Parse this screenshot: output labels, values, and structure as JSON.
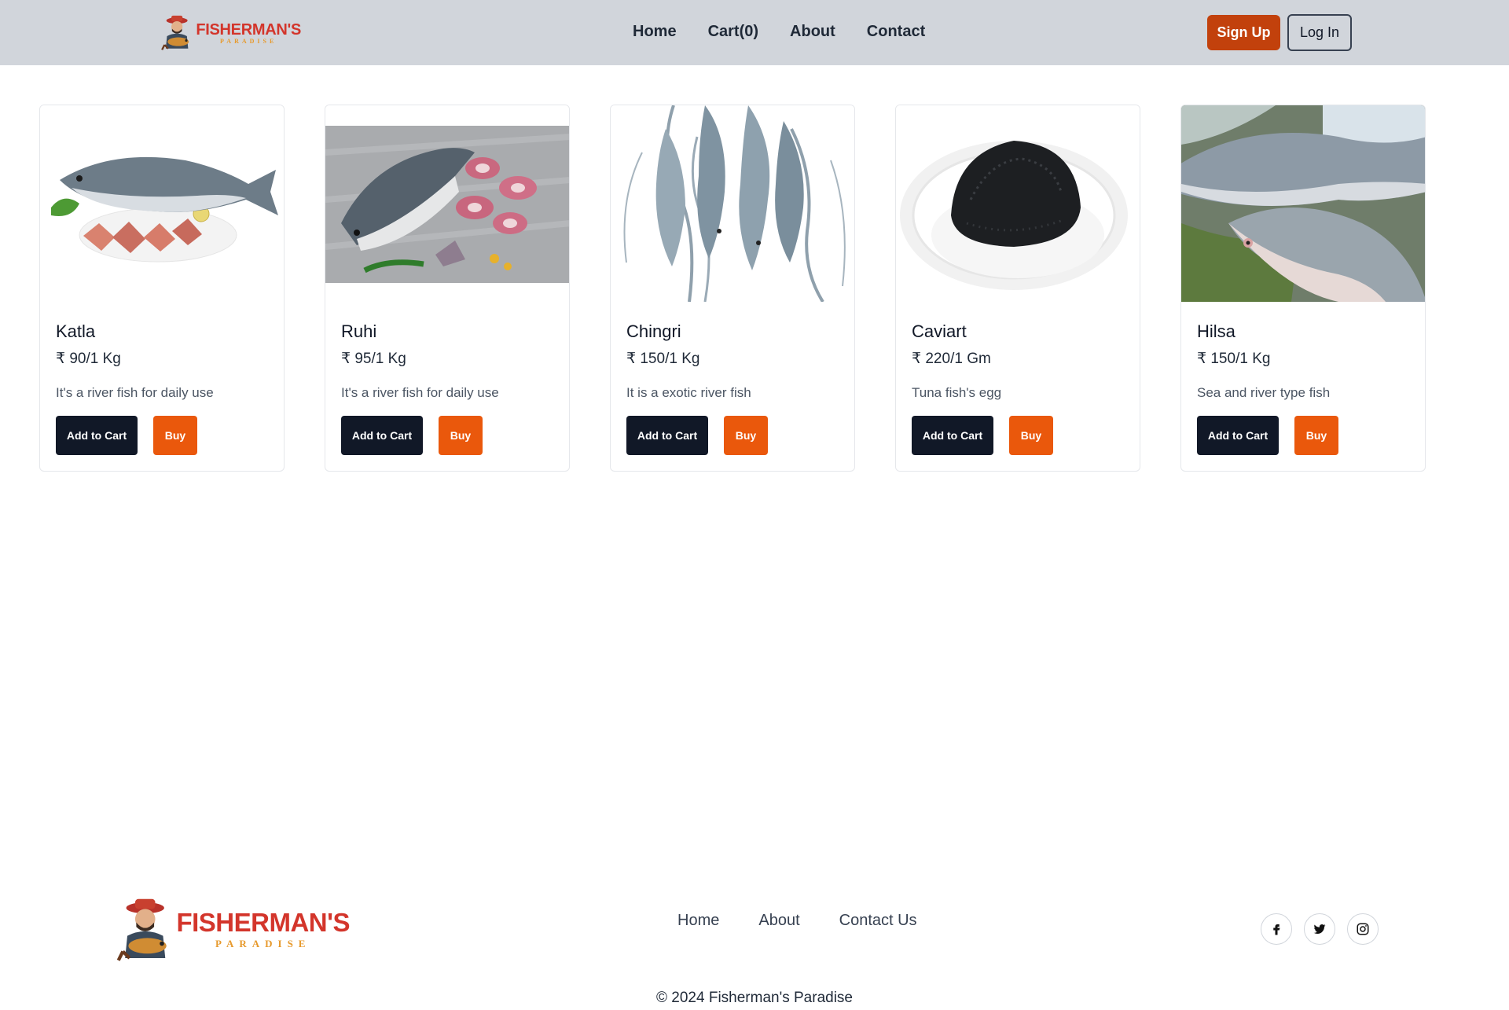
{
  "header": {
    "brand_title": "FISHERMAN'S",
    "brand_sub": "PARADISE",
    "nav": [
      "Home",
      "Cart(0)",
      "About",
      "Contact"
    ],
    "signup_label": "Sign Up",
    "login_label": "Log In"
  },
  "products": [
    {
      "name": "Katla",
      "price": "₹ 90/1 Kg",
      "description": "It's a river fish for daily use",
      "add_label": "Add to Cart",
      "buy_label": "Buy"
    },
    {
      "name": "Ruhi",
      "price": "₹ 95/1 Kg",
      "description": "It's a river fish for daily use",
      "add_label": "Add to Cart",
      "buy_label": "Buy"
    },
    {
      "name": "Chingri",
      "price": "₹ 150/1 Kg",
      "description": "It is a exotic river fish",
      "add_label": "Add to Cart",
      "buy_label": "Buy"
    },
    {
      "name": "Caviart",
      "price": "₹ 220/1 Gm",
      "description": "Tuna fish's egg",
      "add_label": "Add to Cart",
      "buy_label": "Buy"
    },
    {
      "name": "Hilsa",
      "price": "₹ 150/1 Kg",
      "description": "Sea and river type fish",
      "add_label": "Add to Cart",
      "buy_label": "Buy"
    }
  ],
  "footer": {
    "brand_title": "FISHERMAN'S",
    "brand_sub": "PARADISE",
    "nav": [
      "Home",
      "About",
      "Contact Us"
    ],
    "social_icons": [
      "facebook-icon",
      "twitter-icon",
      "instagram-icon"
    ],
    "copyright": "© 2024 Fisherman's Paradise"
  },
  "colors": {
    "header_bg": "#d1d5db",
    "signup_bg": "#c2410c",
    "cart_button_bg": "#111827",
    "buy_button_bg": "#ea580c",
    "brand_red": "#d3352b",
    "brand_gold": "#e79a2d"
  }
}
